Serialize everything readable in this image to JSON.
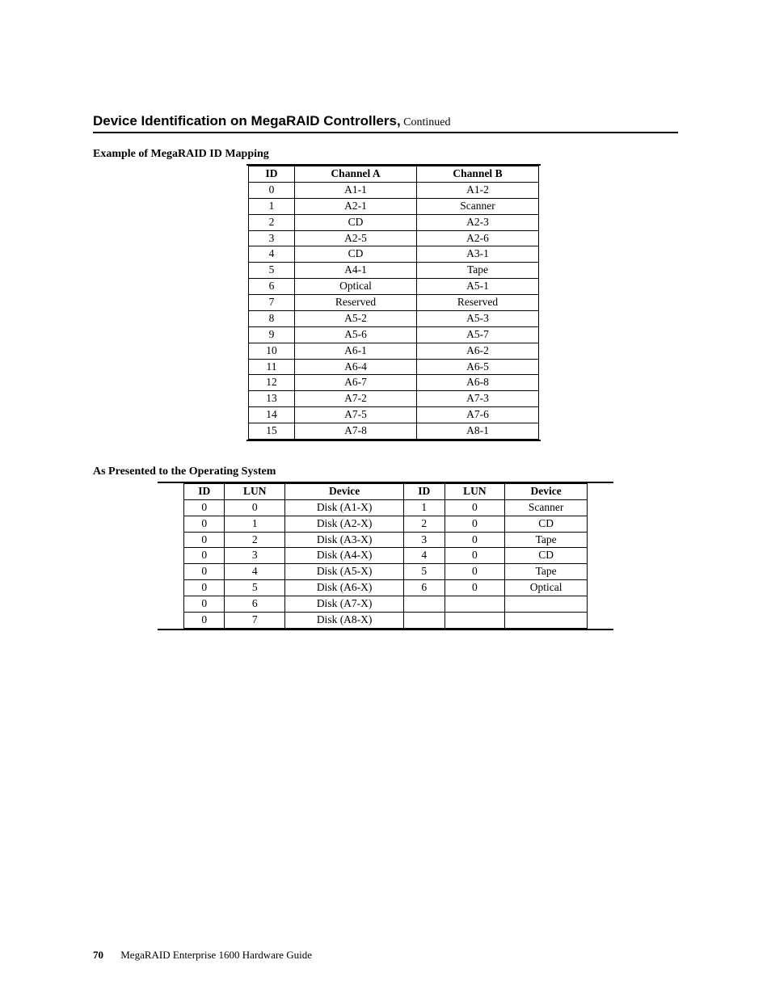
{
  "title_main": "Device Identification on MegaRAID Controllers,",
  "title_cont": " Continued",
  "section1_heading": "Example of MegaRAID ID Mapping",
  "table1": {
    "headers": [
      "ID",
      "Channel A",
      "Channel B"
    ],
    "rows": [
      [
        "0",
        "A1-1",
        "A1-2"
      ],
      [
        "1",
        "A2-1",
        "Scanner"
      ],
      [
        "2",
        "CD",
        "A2-3"
      ],
      [
        "3",
        "A2-5",
        "A2-6"
      ],
      [
        "4",
        "CD",
        "A3-1"
      ],
      [
        "5",
        "A4-1",
        "Tape"
      ],
      [
        "6",
        "Optical",
        "A5-1"
      ],
      [
        "7",
        "Reserved",
        "Reserved"
      ],
      [
        "8",
        "A5-2",
        "A5-3"
      ],
      [
        "9",
        "A5-6",
        "A5-7"
      ],
      [
        "10",
        "A6-1",
        "A6-2"
      ],
      [
        "11",
        "A6-4",
        "A6-5"
      ],
      [
        "12",
        "A6-7",
        "A6-8"
      ],
      [
        "13",
        "A7-2",
        "A7-3"
      ],
      [
        "14",
        "A7-5",
        "A7-6"
      ],
      [
        "15",
        "A7-8",
        "A8-1"
      ]
    ]
  },
  "section2_heading": "As Presented to the Operating System",
  "table2": {
    "headers": [
      "ID",
      "LUN",
      "Device",
      "ID",
      "LUN",
      "Device"
    ],
    "rows": [
      [
        "0",
        "0",
        "Disk (A1-X)",
        "1",
        "0",
        "Scanner"
      ],
      [
        "0",
        "1",
        "Disk (A2-X)",
        "2",
        "0",
        "CD"
      ],
      [
        "0",
        "2",
        "Disk (A3-X)",
        "3",
        "0",
        "Tape"
      ],
      [
        "0",
        "3",
        "Disk (A4-X)",
        "4",
        "0",
        "CD"
      ],
      [
        "0",
        "4",
        "Disk (A5-X)",
        "5",
        "0",
        "Tape"
      ],
      [
        "0",
        "5",
        "Disk (A6-X)",
        "6",
        "0",
        "Optical"
      ],
      [
        "0",
        "6",
        "Disk (A7-X)",
        "",
        "",
        ""
      ],
      [
        "0",
        "7",
        "Disk (A8-X)",
        "",
        "",
        ""
      ]
    ]
  },
  "footer": {
    "page_number": "70",
    "doc_title": "MegaRAID Enterprise 1600 Hardware Guide"
  }
}
